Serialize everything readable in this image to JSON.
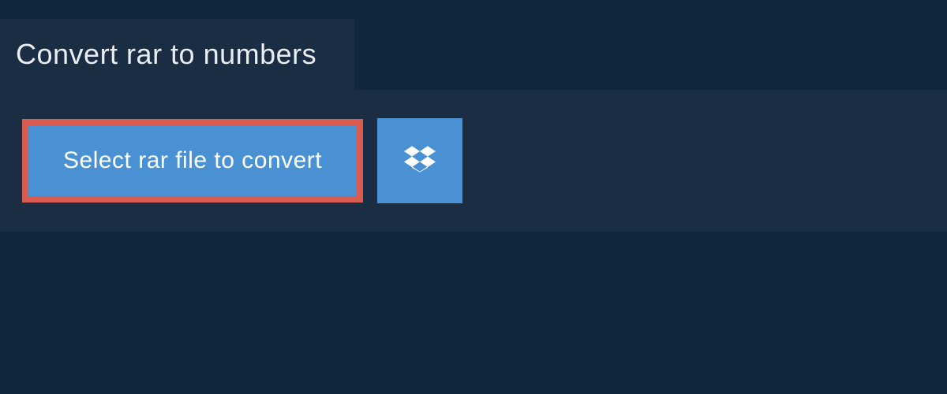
{
  "header": {
    "title": "Convert rar to numbers"
  },
  "actions": {
    "select_file_label": "Select rar file to convert",
    "dropbox_icon": "dropbox-icon"
  },
  "colors": {
    "page_bg": "#11273e",
    "panel_bg": "#1a2d42",
    "button_bg": "#4a91d4",
    "highlight_border": "#d85b4f",
    "text_light": "#e8eef4",
    "text_white": "#ffffff"
  }
}
